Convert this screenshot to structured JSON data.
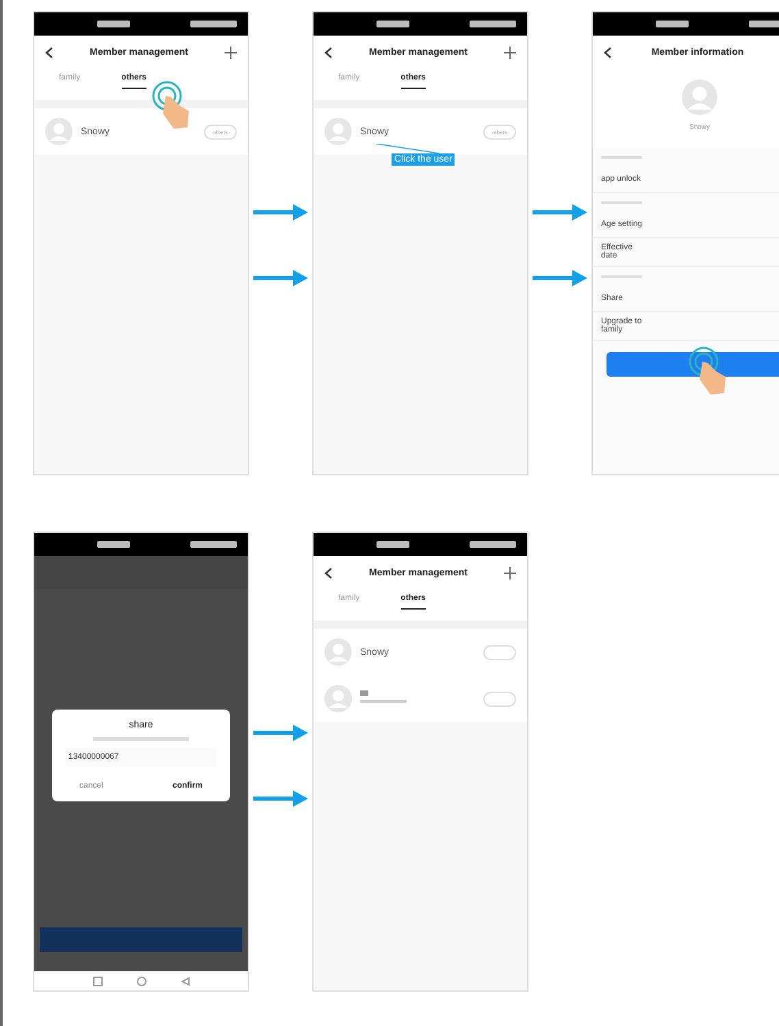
{
  "rows": [
    {
      "screens": [
        {
          "kind": "members",
          "title": "Member management",
          "tap": true,
          "tabs": [
            {
              "label": "family",
              "selected": false
            },
            {
              "label": "others",
              "selected": true
            }
          ],
          "members": [
            {
              "name": "Snowy",
              "badge": "others"
            }
          ]
        },
        {
          "kind": "members",
          "title": "Member management",
          "tap": false,
          "callout": "Click the user",
          "tabs": [
            {
              "label": "family",
              "selected": false
            },
            {
              "label": "others",
              "selected": true
            }
          ],
          "members": [
            {
              "name": "Snowy",
              "badge": "others"
            }
          ]
        },
        {
          "kind": "info",
          "title": "Member information",
          "tap": true,
          "name": "Snowy",
          "items": [
            {
              "kind": "section"
            },
            {
              "kind": "row",
              "label": "app unlock"
            },
            {
              "kind": "section"
            },
            {
              "kind": "row",
              "label": "Age setting"
            },
            {
              "kind": "row",
              "label": "Effective date"
            },
            {
              "kind": "section"
            },
            {
              "kind": "row",
              "label": "Share"
            },
            {
              "kind": "row",
              "label": "Upgrade to family"
            }
          ]
        }
      ]
    },
    {
      "screens": [
        {
          "kind": "dialog",
          "title": "share",
          "value": "13400000067",
          "buttons": [
            "cancel",
            "confirm"
          ]
        },
        {
          "kind": "members",
          "title": "Member management",
          "tap": false,
          "tabs": [
            {
              "label": "family",
              "selected": false
            },
            {
              "label": "others",
              "selected": true
            }
          ],
          "members": [
            {
              "kind": "named",
              "name": "Snowy"
            },
            {
              "kind": "blurred"
            }
          ]
        }
      ]
    }
  ]
}
